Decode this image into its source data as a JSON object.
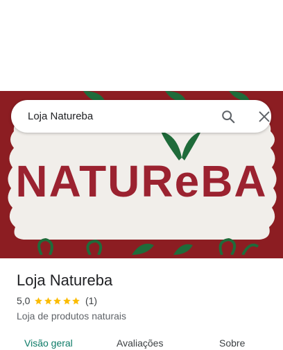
{
  "search": {
    "query": "Loja Natureba"
  },
  "hero": {
    "sign_text": "NATUREBA",
    "sign_color": "#9b2230",
    "leaf_color": "#1f6b3a",
    "border_color": "#8c1d22"
  },
  "place": {
    "title": "Loja Natureba",
    "rating": "5,0",
    "stars": 5,
    "review_count": "(1)",
    "category": "Loja de produtos naturais",
    "star_color": "#fbbc04"
  },
  "tabs": [
    {
      "label": "Visão geral",
      "active": true
    },
    {
      "label": "Avaliações",
      "active": false
    },
    {
      "label": "Sobre",
      "active": false
    }
  ],
  "colors": {
    "accent": "#0b7a66"
  }
}
